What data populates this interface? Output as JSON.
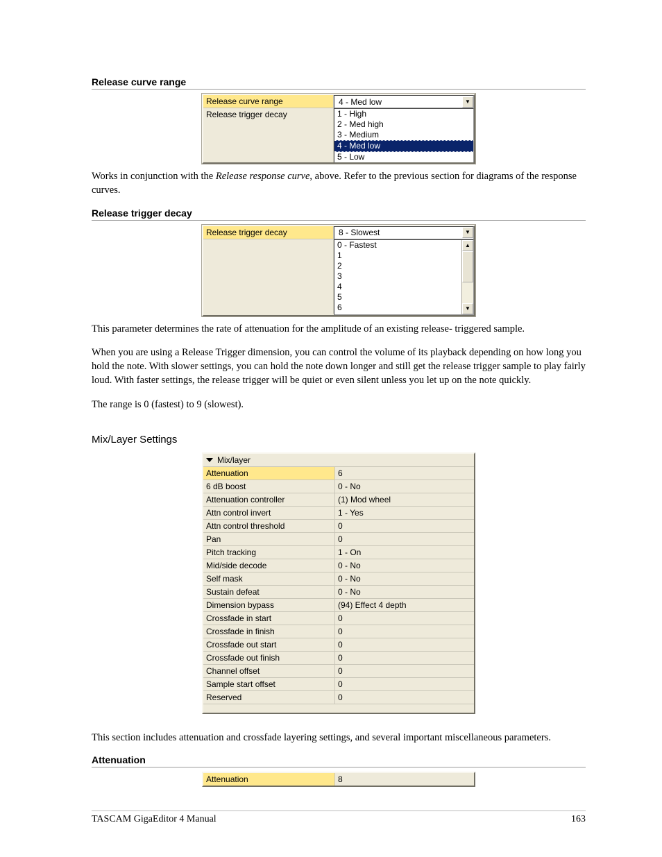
{
  "sections": {
    "release_curve_range": {
      "heading": "Release curve range",
      "panel": {
        "row1_label": "Release curve range",
        "row1_value": "4 - Med low",
        "row2_label": "Release trigger decay",
        "options": [
          "1 - High",
          "2 - Med high",
          "3 - Medium",
          "4 - Med low",
          "5 - Low"
        ],
        "selected_index": 3
      },
      "paragraph_a": "Works in conjunction with the ",
      "paragraph_italic": "Release response curve",
      "paragraph_b": ", above.  Refer to the previous section for diagrams of the response curves."
    },
    "release_trigger_decay": {
      "heading": "Release trigger decay",
      "panel": {
        "row1_label": "Release trigger decay",
        "row1_value": "8 - Slowest",
        "options": [
          "0 - Fastest",
          "1",
          "2",
          "3",
          "4",
          "5",
          "6"
        ]
      },
      "para1": "This parameter determines the rate of attenuation for the amplitude of an existing release- triggered sample.",
      "para2": "When you are using a Release Trigger dimension, you can control the volume of its playback depending on how long you hold the note.  With slower settings, you can hold the note down longer and still get the release trigger sample to play fairly loud.  With faster settings, the release trigger will be quiet or even silent unless you let up on the note quickly.",
      "para3": "The range is 0 (fastest) to 9 (slowest)."
    },
    "mix_layer": {
      "heading": "Mix/Layer Settings",
      "panel_header": "Mix/layer",
      "rows": [
        {
          "label": "Attenuation",
          "value": "6",
          "highlight": true
        },
        {
          "label": "6 dB boost",
          "value": "0 - No"
        },
        {
          "label": "Attenuation controller",
          "value": "(1) Mod wheel"
        },
        {
          "label": "Attn control invert",
          "value": "1 - Yes"
        },
        {
          "label": "Attn control threshold",
          "value": "0"
        },
        {
          "label": "Pan",
          "value": "0"
        },
        {
          "label": "Pitch tracking",
          "value": "1 - On"
        },
        {
          "label": "Mid/side decode",
          "value": "0 - No"
        },
        {
          "label": "Self mask",
          "value": "0 - No"
        },
        {
          "label": "Sustain defeat",
          "value": "0 - No"
        },
        {
          "label": "Dimension bypass",
          "value": "(94) Effect 4 depth"
        },
        {
          "label": "Crossfade in start",
          "value": "0"
        },
        {
          "label": "Crossfade in finish",
          "value": "0"
        },
        {
          "label": "Crossfade out start",
          "value": "0"
        },
        {
          "label": "Crossfade out finish",
          "value": "0"
        },
        {
          "label": "Channel offset",
          "value": "0"
        },
        {
          "label": "Sample start offset",
          "value": "0"
        },
        {
          "label": "Reserved",
          "value": "0"
        }
      ],
      "para": "This section includes attenuation and crossfade layering settings, and several important miscellaneous parameters."
    },
    "attenuation": {
      "heading": "Attenuation",
      "panel": {
        "label": "Attenuation",
        "value": "8"
      }
    }
  },
  "footer": {
    "left": "TASCAM GigaEditor 4 Manual",
    "right": "163"
  }
}
